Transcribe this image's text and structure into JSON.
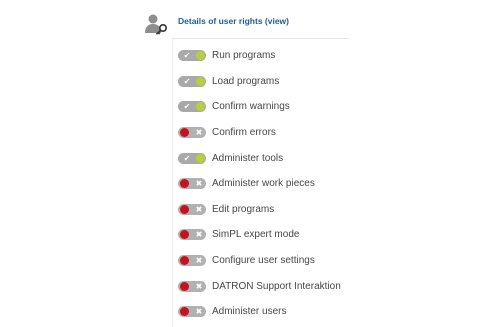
{
  "header": {
    "title": "Details of user rights (view)",
    "icon": "user-key-icon"
  },
  "colors": {
    "title": "#1f5d96",
    "toggle_on_indicator": "#b6cf3a",
    "toggle_off_indicator": "#c5121b",
    "label_text": "#474747"
  },
  "rights": [
    {
      "label": "Run programs",
      "enabled": true
    },
    {
      "label": "Load programs",
      "enabled": true
    },
    {
      "label": "Confirm warnings",
      "enabled": true
    },
    {
      "label": "Confirm errors",
      "enabled": false
    },
    {
      "label": "Administer tools",
      "enabled": true
    },
    {
      "label": "Administer work pieces",
      "enabled": false
    },
    {
      "label": "Edit programs",
      "enabled": false
    },
    {
      "label": "SimPL expert mode",
      "enabled": false
    },
    {
      "label": "Configure user settings",
      "enabled": false
    },
    {
      "label": "DATRON Support Interaktion",
      "enabled": false
    },
    {
      "label": "Administer users",
      "enabled": false
    }
  ]
}
